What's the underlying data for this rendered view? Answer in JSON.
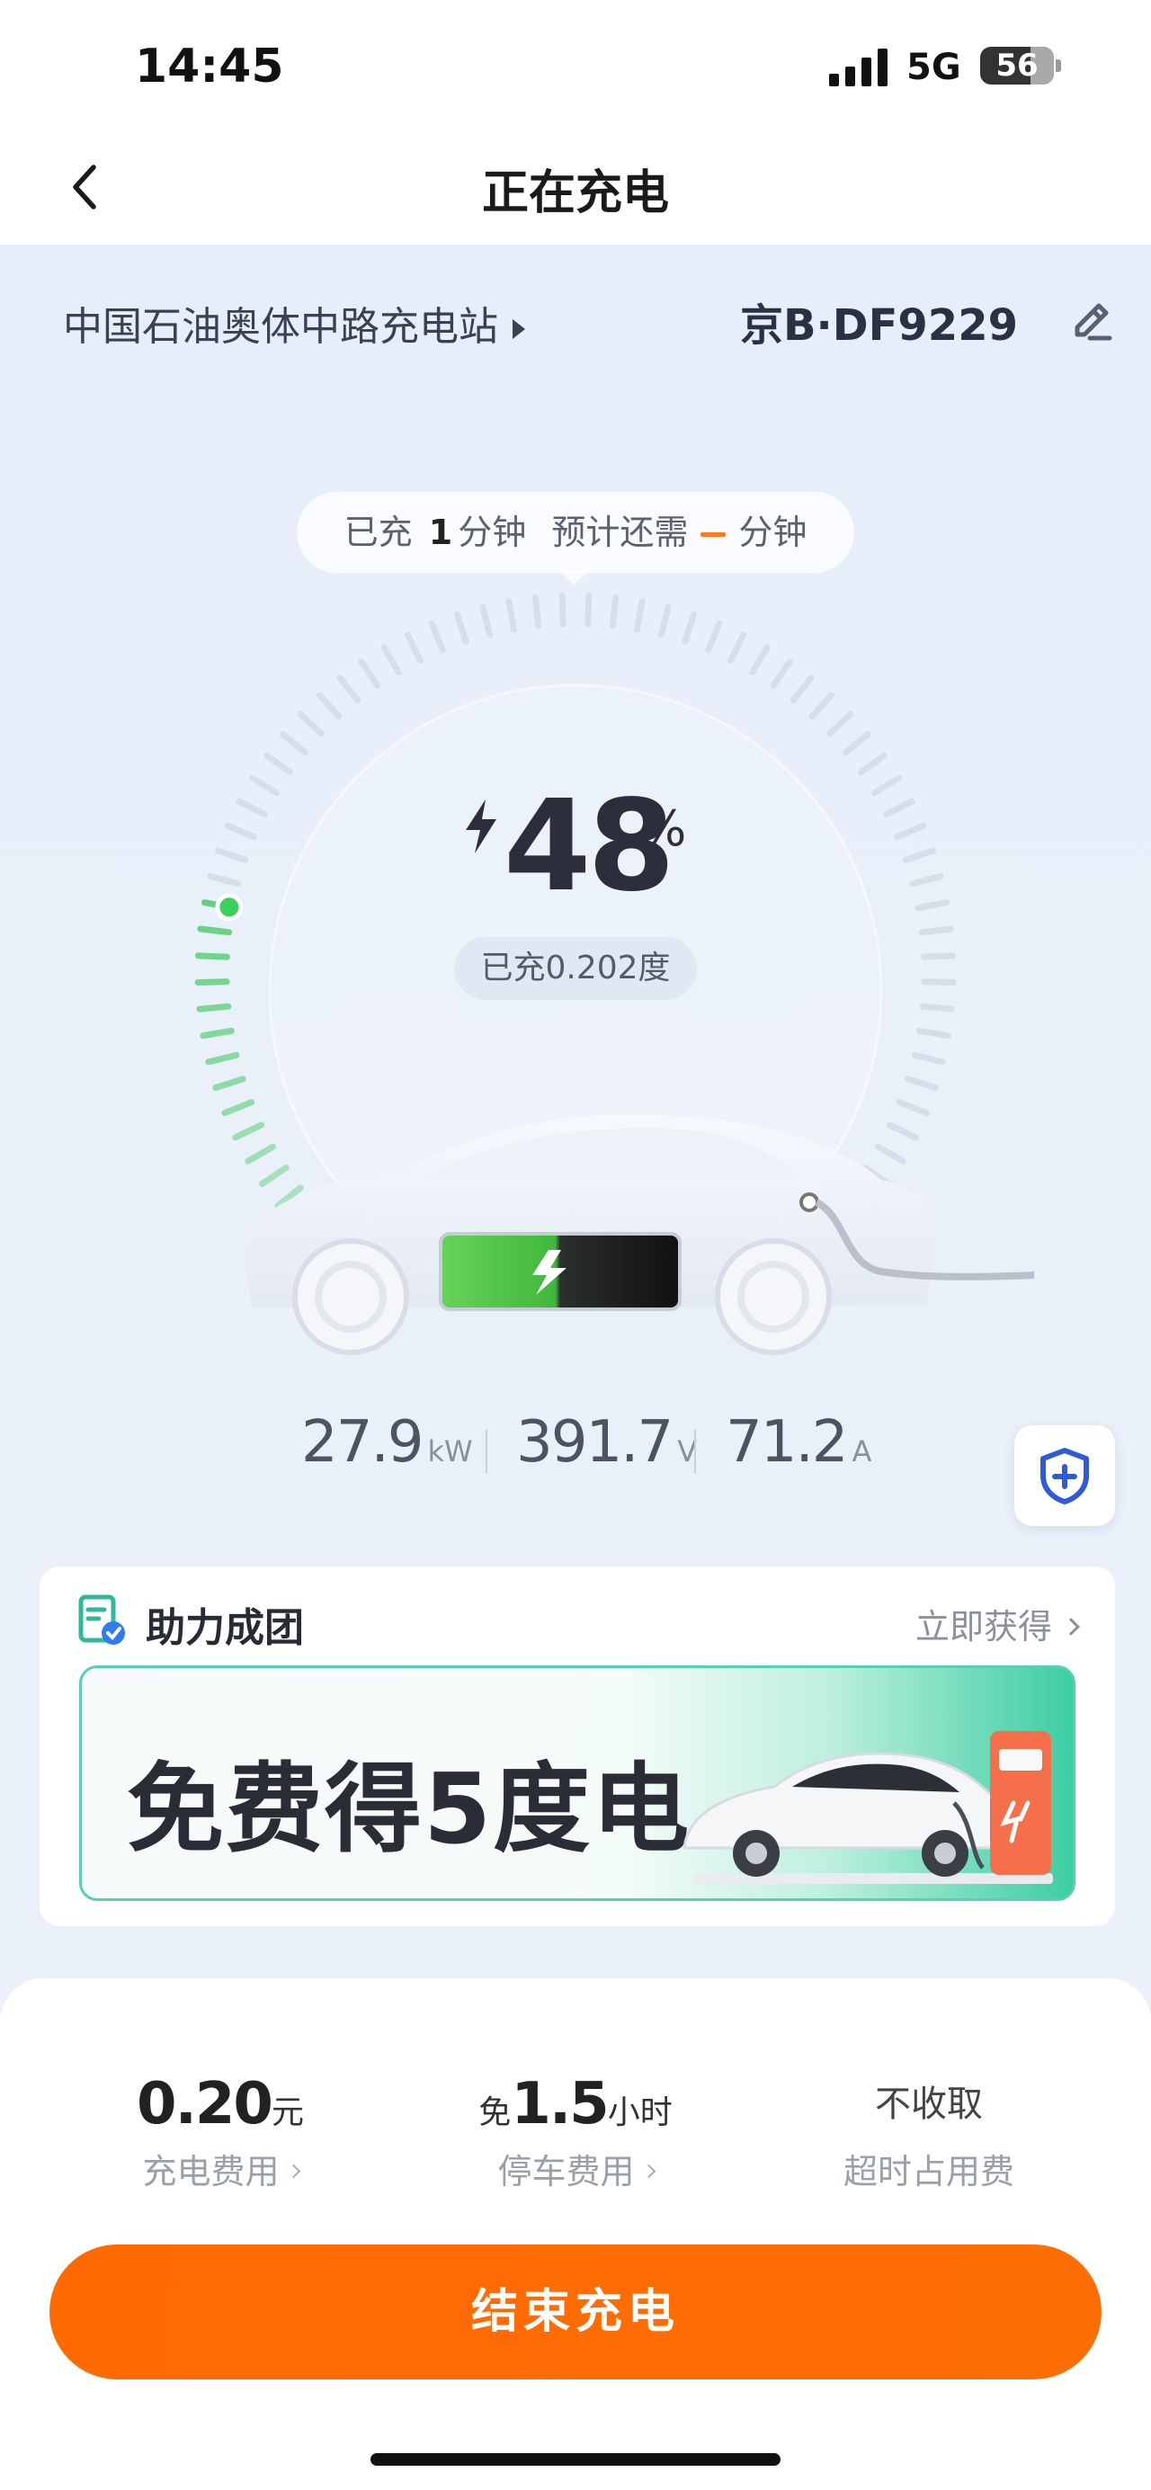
{
  "status_bar": {
    "time": "14:45",
    "network": "5G",
    "battery": "56"
  },
  "nav": {
    "title": "正在充电"
  },
  "station": {
    "name": "中国石油奥体中路充电站",
    "plate": "京B·DF9229"
  },
  "charging": {
    "elapsed_prefix": "已充",
    "elapsed_value": "1",
    "elapsed_unit": "分钟",
    "remaining_prefix": "预计还需",
    "remaining_unit": "分钟",
    "percent_value": "48",
    "percent_sign": "%",
    "percent_fraction": 0.48,
    "energy": "已充0.202度"
  },
  "metrics": [
    {
      "value": "27.9",
      "unit": "kW"
    },
    {
      "value": "391.7",
      "unit": "V"
    },
    {
      "value": "71.2",
      "unit": "A"
    }
  ],
  "promo": {
    "title": "助力成团",
    "link": "立即获得",
    "banner": "免费得5度电"
  },
  "fees": {
    "charge": {
      "value": "0.20",
      "unit": "元",
      "label": "充电费用"
    },
    "parking": {
      "prefix": "免",
      "value": "1.5",
      "unit": "小时",
      "label": "停车费用"
    },
    "overtime": {
      "value": "不收取",
      "label": "超时占用费"
    }
  },
  "actions": {
    "end_charging": "结束充电"
  },
  "colors": {
    "accent": "#ff6a00",
    "progress": "#5fd07a",
    "teal": "#3ecda2"
  }
}
